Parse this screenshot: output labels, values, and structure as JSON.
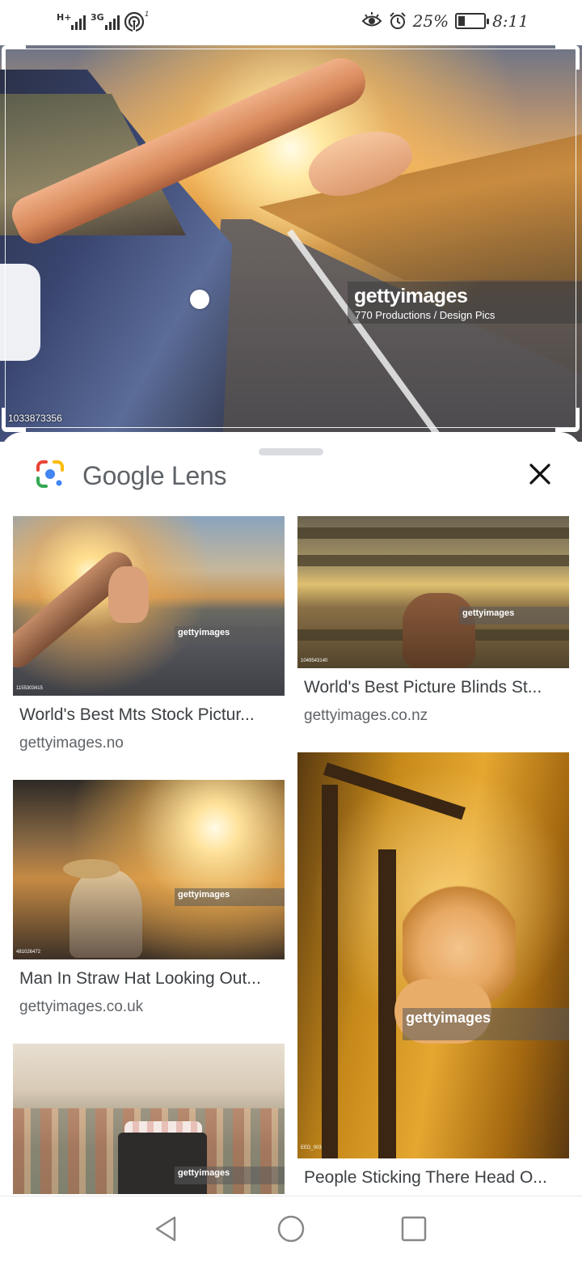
{
  "status_bar": {
    "sim1_tag": "H+",
    "sim2_tag": "3G",
    "wifi_badge": "1",
    "battery_percent": "25%",
    "battery_level": 0.25,
    "time": "8:11",
    "icons": [
      "eye-comfort-icon",
      "alarm-icon",
      "battery-icon",
      "wifi-icon",
      "signal-icon"
    ]
  },
  "hero_image": {
    "watermark_brand": "gettyimages",
    "watermark_credit": "770 Productions / Design Pics",
    "image_id": "1033873356"
  },
  "lens": {
    "title_brand": "Google",
    "title_product": "Lens",
    "logo_colors": [
      "#4285F4",
      "#EA4335",
      "#FBBC05",
      "#34A853"
    ]
  },
  "results": [
    {
      "title": "World's Best Mts Stock Pictur...",
      "source": "gettyimages.no",
      "watermark": "gettyimages",
      "image_id": "1155303415"
    },
    {
      "title": "World's Best Picture Blinds St...",
      "source": "gettyimages.co.nz",
      "watermark": "gettyimages",
      "image_id": "1049543140"
    },
    {
      "title": "Man In Straw Hat Looking Out...",
      "source": "gettyimages.co.uk",
      "watermark": "gettyimages",
      "image_id": "481026472"
    },
    {
      "title": "People Sticking There Head O...",
      "source": "",
      "watermark": "gettyimages",
      "image_id": "EED_003"
    },
    {
      "title": "",
      "source": "",
      "watermark": "gettyimages",
      "image_id": ""
    }
  ],
  "nav": {
    "icons": [
      "back-icon",
      "home-icon",
      "recents-icon"
    ]
  }
}
